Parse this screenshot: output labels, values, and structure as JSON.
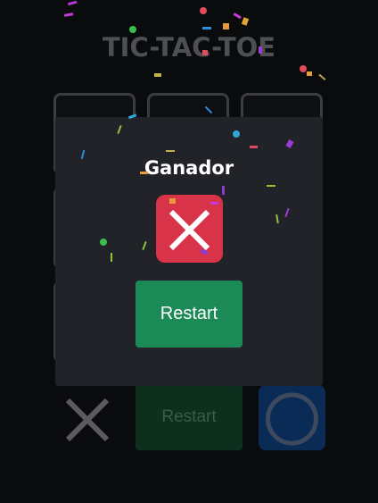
{
  "game": {
    "title": "TIC-TAC-TOE",
    "board": [
      "",
      "",
      "",
      "",
      "",
      "",
      "",
      "",
      ""
    ],
    "footer": {
      "player_x": "x-icon",
      "restart_label": "Restart",
      "player_o": "o-icon"
    }
  },
  "modal": {
    "heading": "Ganador",
    "winner_icon": "x-icon",
    "restart_label": "Restart"
  },
  "colors": {
    "background": "#0a0b0d",
    "modal": "#212328",
    "winner_badge": "#d9334a",
    "restart_button": "#1c8a56",
    "o_badge": "#0b2b57"
  }
}
